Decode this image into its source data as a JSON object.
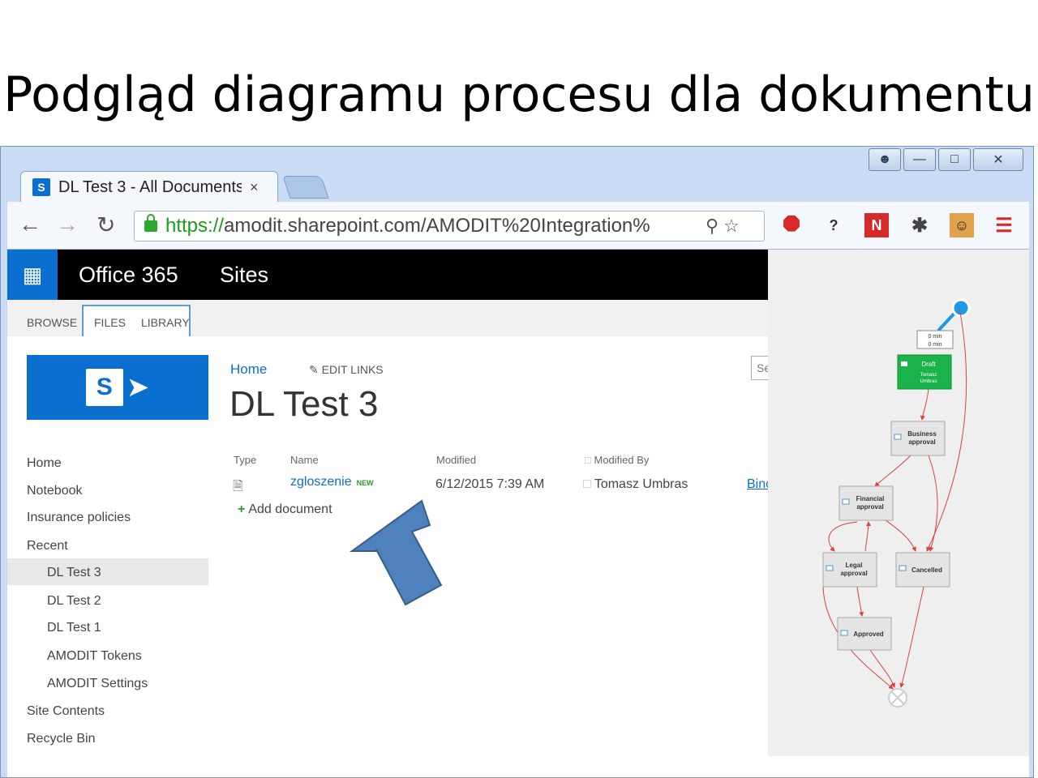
{
  "slide": {
    "title": "Podgląd diagramu procesu dla dokumentu"
  },
  "browser": {
    "tab_title": "DL Test 3 - All Documents",
    "tab_close": "×",
    "url_https": "https://",
    "url_rest": "amodit.sharepoint.com/AMODIT%20Integration%",
    "window_controls": [
      "user-icon",
      "minimize-icon",
      "maximize-icon",
      "close-icon"
    ]
  },
  "o365": {
    "brand": "Office 365",
    "sites": "Sites",
    "waffle": "app-launcher-icon"
  },
  "ribbon": {
    "tabs": [
      "BROWSE",
      "FILES",
      "LIBRARY"
    ]
  },
  "site": {
    "breadcrumb_home": "Home",
    "edit_links": "EDIT LINKS",
    "title": "DL Test 3",
    "search_placeholder": "Se"
  },
  "leftnav": {
    "items": [
      "Home",
      "Notebook",
      "Insurance policies",
      "Recent"
    ],
    "recent_items": [
      "DL Test 3",
      "DL Test 2",
      "DL Test 1",
      "AMODIT Tokens",
      "AMODIT Settings"
    ],
    "bottom_items": [
      "Site Contents",
      "Recycle Bin"
    ],
    "selected": "DL Test 3"
  },
  "doclib": {
    "columns": [
      "Type",
      "Name",
      "Modified",
      "Modified By"
    ],
    "rows": [
      {
        "name": "zgloszenie",
        "badge": "NEW",
        "modified": "6/12/2015 7:39 AM",
        "modified_by": "Tomasz Umbras",
        "extra": "Binc"
      }
    ],
    "add_document": "Add document"
  },
  "diagram": {
    "timer_line1": "0 min",
    "timer_line2": "0 min",
    "nodes": [
      {
        "label1": "Draft",
        "label2": "Tomasz",
        "label3": "Umbras",
        "state": "active"
      },
      {
        "label1": "Business",
        "label2": "approval"
      },
      {
        "label1": "Financial",
        "label2": "approval"
      },
      {
        "label1": "Legal",
        "label2": "approval"
      },
      {
        "label1": "Cancelled"
      },
      {
        "label1": "Approved"
      }
    ],
    "colors": {
      "active": "#19b34a",
      "node": "#e4e4e4",
      "edge": "#e04040",
      "start": "#1a9ae8"
    }
  }
}
